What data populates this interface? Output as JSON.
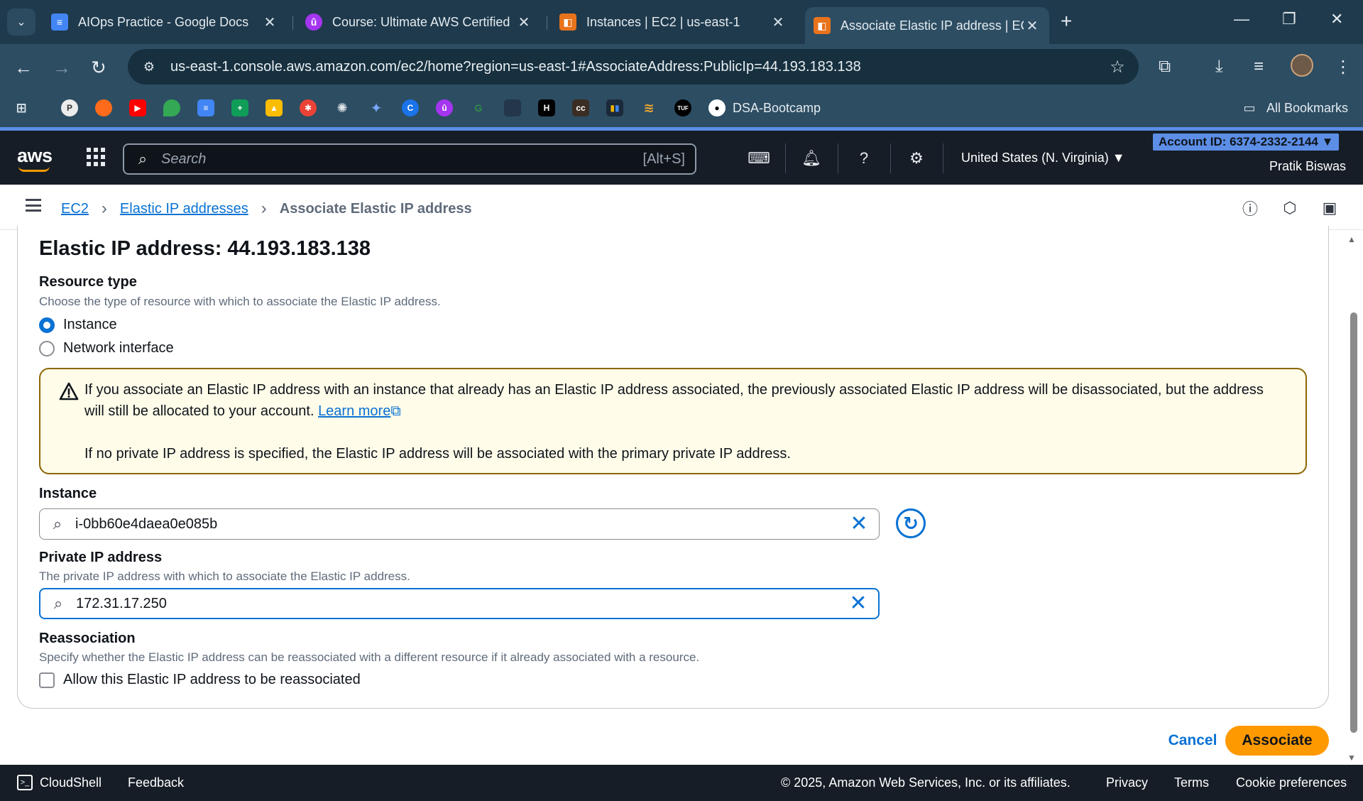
{
  "browser": {
    "tabs": [
      {
        "title": "AIOps Practice - Google Docs",
        "icon": "google-docs-icon",
        "color": "#4285f4"
      },
      {
        "title": "Course: Ultimate AWS Certified",
        "icon": "udemy-icon",
        "color": "#a435f0"
      },
      {
        "title": "Instances | EC2 | us-east-1",
        "icon": "aws-console-icon",
        "color": "#e8731c"
      },
      {
        "title": "Associate Elastic IP address | EC",
        "icon": "aws-console-icon",
        "color": "#e8731c"
      }
    ],
    "url": "us-east-1.console.aws.amazon.com/ec2/home?region=us-east-1#AssociateAddress:PublicIp=44.193.183.138",
    "bookmark_label": "DSA-Bootcamp",
    "all_bookmarks": "All Bookmarks"
  },
  "aws_nav": {
    "logo": "aws",
    "search_placeholder": "Search",
    "search_shortcut": "[Alt+S]",
    "region": "United States (N. Virginia)",
    "account": "Account ID: 6374-2332-2144",
    "user": "Pratik Biswas"
  },
  "breadcrumb": {
    "items": [
      "EC2",
      "Elastic IP addresses"
    ],
    "current": "Associate Elastic IP address"
  },
  "form": {
    "title": "Elastic IP address: 44.193.183.138",
    "resource_type": {
      "label": "Resource type",
      "description": "Choose the type of resource with which to associate the Elastic IP address.",
      "options": [
        "Instance",
        "Network interface"
      ],
      "selected": "Instance"
    },
    "alert": {
      "text": "If you associate an Elastic IP address with an instance that already has an Elastic IP address associated, the previously associated Elastic IP address will be disassociated, but the address will still be allocated to your account.",
      "link": "Learn more",
      "text2": "If no private IP address is specified, the Elastic IP address will be associated with the primary private IP address."
    },
    "instance": {
      "label": "Instance",
      "value": "i-0bb60e4daea0e085b"
    },
    "private_ip": {
      "label": "Private IP address",
      "description": "The private IP address with which to associate the Elastic IP address.",
      "value": "172.31.17.250"
    },
    "reassociation": {
      "label": "Reassociation",
      "description": "Specify whether the Elastic IP address can be reassociated with a different resource if it already associated with a resource.",
      "checkbox_label": "Allow this Elastic IP address to be reassociated",
      "checked": false
    },
    "cancel": "Cancel",
    "submit": "Associate"
  },
  "footer": {
    "cloudshell": "CloudShell",
    "feedback": "Feedback",
    "copyright": "© 2025, Amazon Web Services, Inc. or its affiliates.",
    "privacy": "Privacy",
    "terms": "Terms",
    "cookies": "Cookie preferences"
  },
  "colors": {
    "accent": "#0972d3",
    "primary_button": "#ff9900",
    "warning_border": "#8d6605",
    "warning_bg": "#fffce9"
  }
}
